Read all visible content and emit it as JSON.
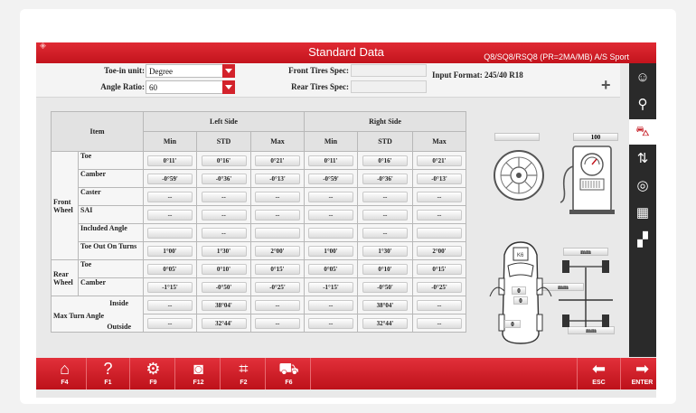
{
  "title": "Standard Data",
  "vehicle_model": "Q8/SQ8/RSQ8 (PR=2MA/MB) A/S Sport",
  "settings": {
    "toe_in_unit_label": "Toe-in unit:",
    "toe_in_unit_value": "Degree",
    "angle_ratio_label": "Angle Ratio:",
    "angle_ratio_value": "60",
    "front_tires_label": "Front Tires Spec:",
    "rear_tires_label": "Rear Tires Spec:",
    "input_format": "Input Format: 245/40 R18",
    "plus_icon": "+"
  },
  "table": {
    "item_header": "Item",
    "left_side": "Left Side",
    "right_side": "Right Side",
    "min": "Min",
    "std": "STD",
    "max": "Max",
    "front_wheel": "Front Wheel",
    "rear_wheel": "Rear Wheel",
    "max_turn_angle": "Max Turn Angle",
    "rows": {
      "toe": {
        "label": "Toe",
        "v": [
          "0°11'",
          "0°16'",
          "0°21'",
          "0°11'",
          "0°16'",
          "0°21'"
        ]
      },
      "camber": {
        "label": "Camber",
        "v": [
          "-0°59'",
          "-0°36'",
          "-0°13'",
          "-0°59'",
          "-0°36'",
          "-0°13'"
        ]
      },
      "caster": {
        "label": "Caster",
        "v": [
          "--",
          "--",
          "--",
          "--",
          "--",
          "--"
        ]
      },
      "sai": {
        "label": "SAI",
        "v": [
          "--",
          "--",
          "--",
          "--",
          "--",
          "--"
        ]
      },
      "included": {
        "label": "Included Angle",
        "v": [
          "",
          "--",
          "",
          "",
          "--",
          ""
        ]
      },
      "toe_out": {
        "label": "Toe Out On Turns",
        "v": [
          "1°00'",
          "1°30'",
          "2°00'",
          "1°00'",
          "1°30'",
          "2°00'"
        ]
      },
      "rear_toe": {
        "label": "Toe",
        "v": [
          "0°05'",
          "0°10'",
          "0°15'",
          "0°05'",
          "0°10'",
          "0°15'"
        ]
      },
      "rear_camber": {
        "label": "Camber",
        "v": [
          "-1°15'",
          "-0°50'",
          "-0°25'",
          "-1°15'",
          "-0°50'",
          "-0°25'"
        ]
      },
      "inside": {
        "label": "Inside",
        "v": [
          "--",
          "38°04'",
          "--",
          "--",
          "38°04'",
          "--"
        ]
      },
      "outside": {
        "label": "Outside",
        "v": [
          "--",
          "32°44'",
          "--",
          "--",
          "32°44'",
          "--"
        ]
      }
    }
  },
  "visual": {
    "pressure_value": "100",
    "mm1": "mm",
    "mm2": "mm",
    "mm3": "mm",
    "zero": "0"
  },
  "sidebar_icons": [
    "technician-icon",
    "car-search-icon",
    "car-data-icon",
    "wheel-adjust-icon",
    "steering-wheel-icon",
    "table-icon",
    "checker-car-icon"
  ],
  "bottom_keys": [
    {
      "icon": "home-icon",
      "key": "F4"
    },
    {
      "icon": "help-icon",
      "key": "F1"
    },
    {
      "icon": "gears-icon",
      "key": "F9"
    },
    {
      "icon": "camera-icon",
      "key": "F12"
    },
    {
      "icon": "grid-icon",
      "key": "F2"
    },
    {
      "icon": "lift-icon",
      "key": "F6"
    },
    {
      "icon": "back-arrow-icon",
      "key": "ESC"
    },
    {
      "icon": "enter-arrow-icon",
      "key": "ENTER"
    }
  ],
  "colors": {
    "accent": "#c3141d",
    "sidebar": "#2a2a2a"
  }
}
